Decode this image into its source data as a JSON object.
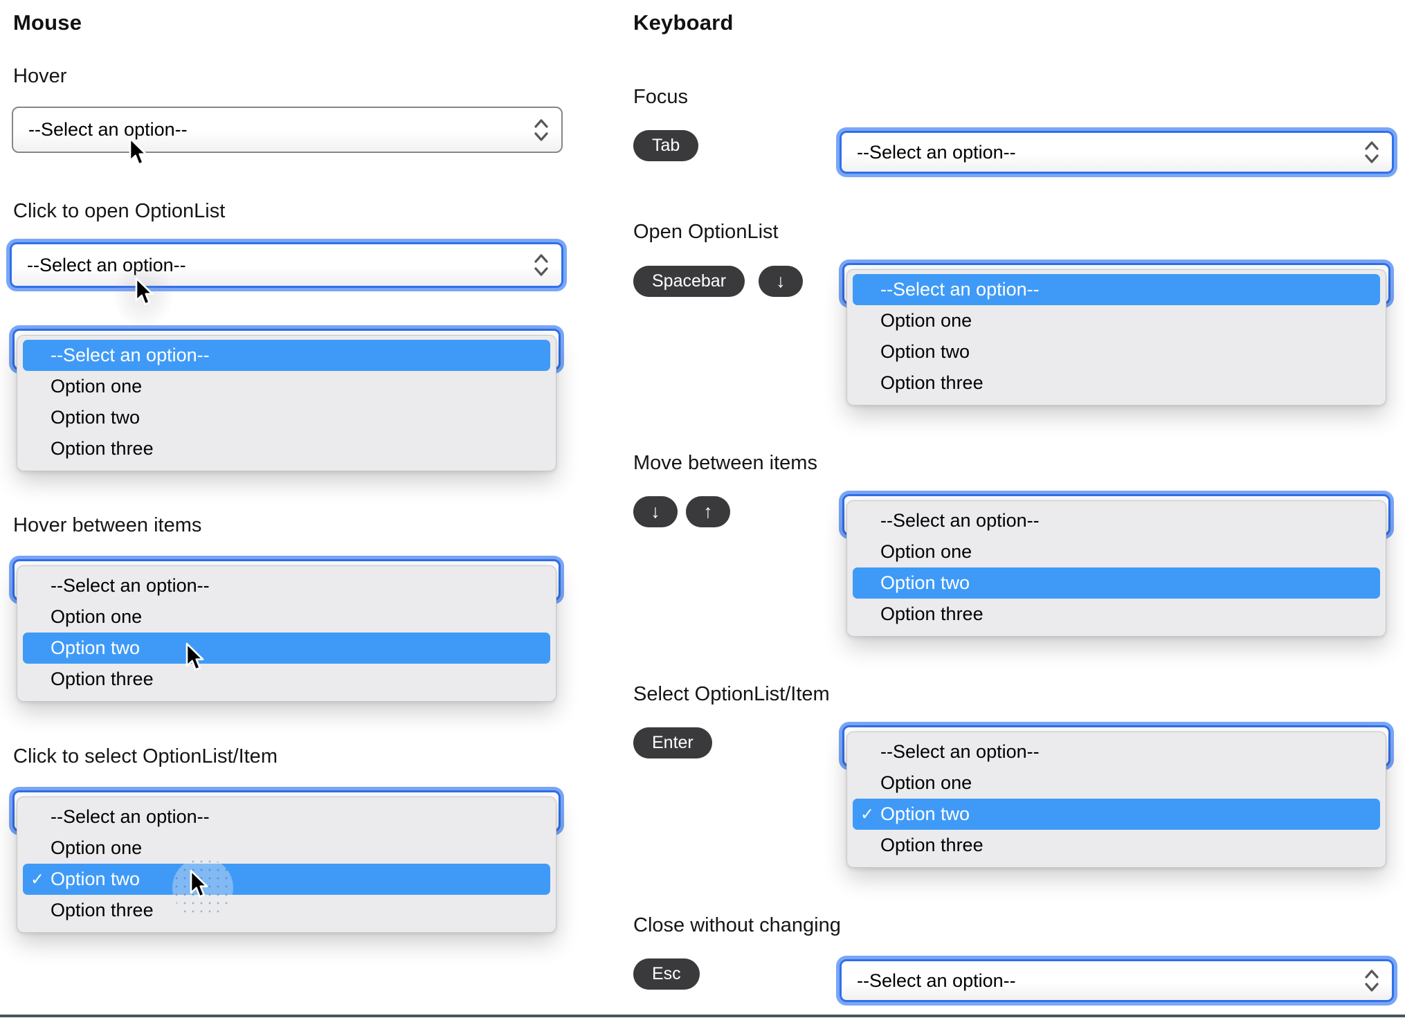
{
  "titles": {
    "mouse": "Mouse",
    "keyboard": "Keyboard"
  },
  "placeholder": "--Select an option--",
  "options": [
    "--Select an option--",
    "Option one",
    "Option two",
    "Option three"
  ],
  "icons": {
    "check": "✓",
    "chevron": "up-down-chevron",
    "cursor": "arrow-pointer"
  },
  "mouse_sections": {
    "hover": "Hover",
    "click_open": "Click to open OptionList",
    "hover_items": "Hover between items",
    "click_select": "Click to select OptionList/Item"
  },
  "keyboard_sections": {
    "focus": "Focus",
    "open": "Open OptionList",
    "move": "Move between items",
    "select": "Select OptionList/Item",
    "close": "Close without changing"
  },
  "keys": {
    "tab": "Tab",
    "spacebar": "Spacebar",
    "enter": "Enter",
    "esc": "Esc",
    "down": "↓",
    "up": "↑"
  },
  "colors": {
    "highlight_blue": "#3f9af7",
    "focus_ring_outer": "#7aa6f8",
    "focus_ring_inner": "#2f6fe8",
    "badge_bg": "#3a3a3c",
    "panel_bg": "#ebebed",
    "panel_border": "#c7c7c9",
    "select_border": "#85858a",
    "bottom_edge": "#46565f"
  }
}
